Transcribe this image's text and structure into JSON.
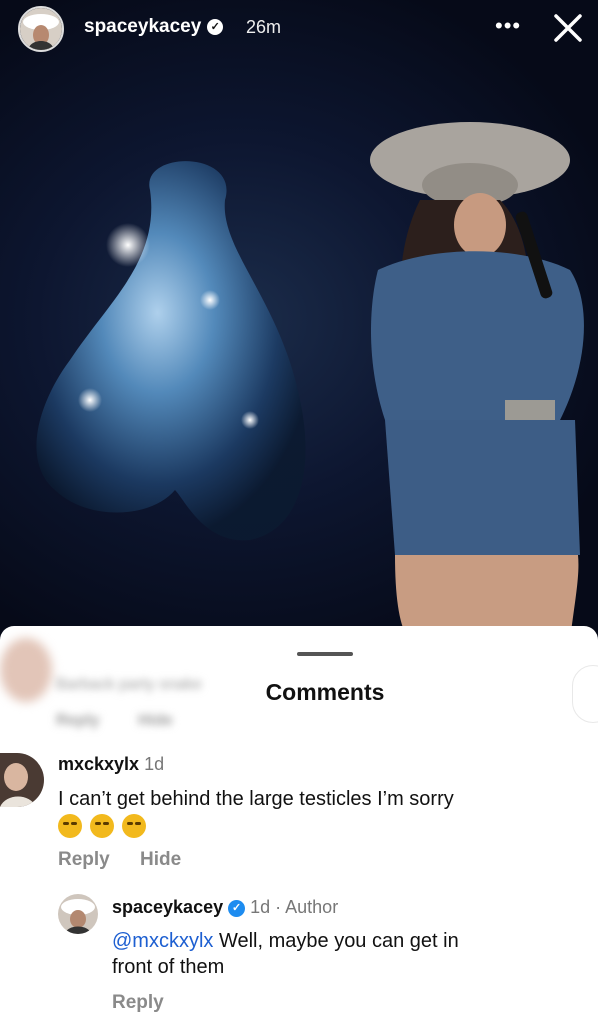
{
  "story": {
    "username": "spaceykacey",
    "time": "26m",
    "more_label": "•••"
  },
  "sheet": {
    "title": "Comments",
    "blurred_comment": {
      "text": "Barback party snake",
      "reply": "Reply",
      "hide": "Hide"
    },
    "comments": [
      {
        "username": "mxckxylx",
        "time": "1d",
        "text": "I can’t get behind the large testicles I’m sorry",
        "emoji_count": 3,
        "reply": "Reply",
        "hide": "Hide"
      }
    ],
    "reply": {
      "username": "spaceykacey",
      "meta": "1d · Author",
      "mention": "@mxckxylx",
      "text_line1": " Well, maybe you can get in",
      "text_line2": "front of them",
      "reply": "Reply"
    }
  }
}
